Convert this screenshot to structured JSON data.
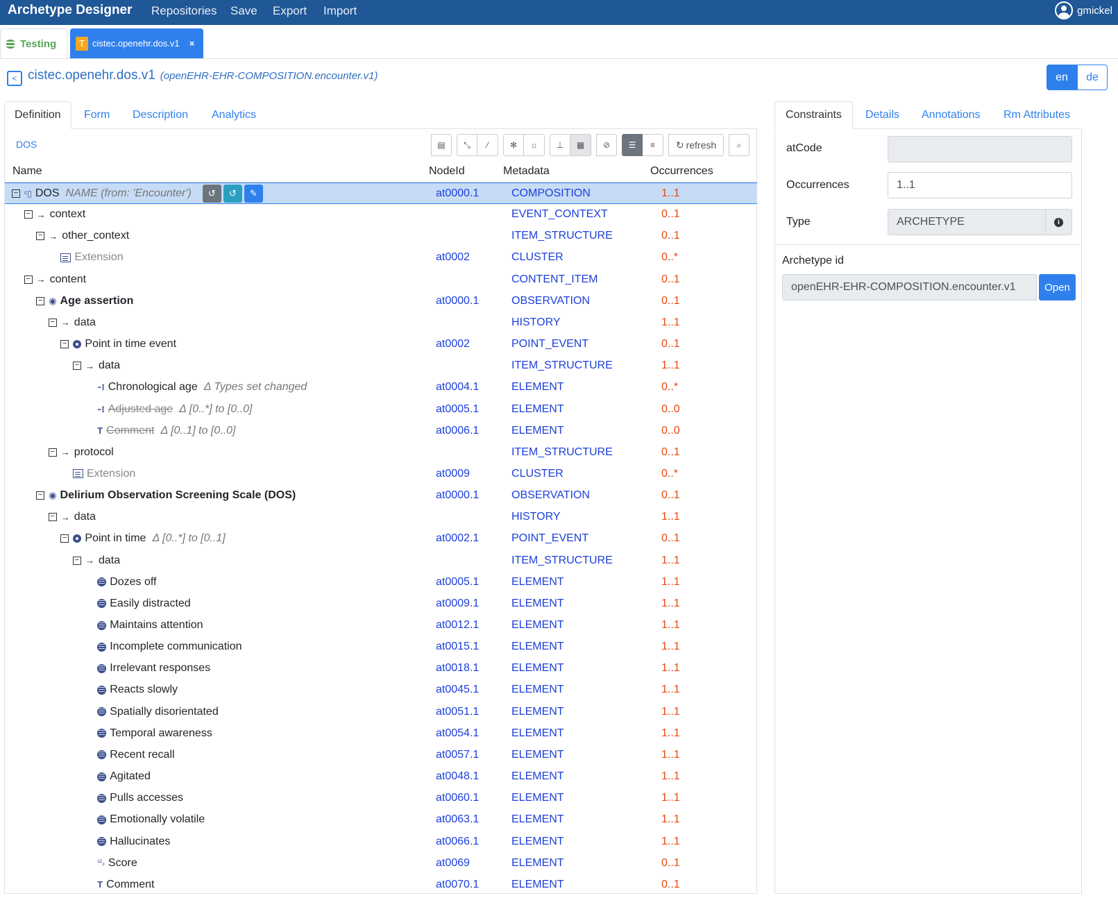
{
  "navbar": {
    "brand": "Archetype Designer",
    "items": [
      "Repositories",
      "Save",
      "Export",
      "Import"
    ],
    "user": "gmickel"
  },
  "doc_tabs": {
    "testing": "Testing",
    "active_badge": "T",
    "active": "cistec.openehr.dos.v1",
    "close": "×"
  },
  "title": {
    "main": "cistec.openehr.dos.v1",
    "sub": "(openEHR-EHR-COMPOSITION.encounter.v1)"
  },
  "lang": {
    "en": "en",
    "de": "de"
  },
  "left_tabs": [
    "Definition",
    "Form",
    "Description",
    "Analytics"
  ],
  "toolbar": {
    "root_link": "DOS",
    "refresh": "refresh"
  },
  "table": {
    "headers": {
      "name": "Name",
      "node": "NodeId",
      "meta": "Metadata",
      "occ": "Occurrences"
    },
    "rows": [
      {
        "depth": 0,
        "toggle": true,
        "icon": "composition-icon",
        "name": "DOS",
        "note": "NAME (from: 'Encounter')",
        "node": "at0000.1",
        "meta": "COMPOSITION",
        "occ": "1..1",
        "selected": true
      },
      {
        "depth": 1,
        "toggle": true,
        "arrow": true,
        "name": "context",
        "node": "",
        "meta": "EVENT_CONTEXT",
        "occ": "0..1"
      },
      {
        "depth": 2,
        "toggle": true,
        "arrow": true,
        "name": "other_context",
        "node": "",
        "meta": "ITEM_STRUCTURE",
        "occ": "0..1"
      },
      {
        "depth": 4,
        "icon": "cluster-icon",
        "name": "Extension",
        "grey": true,
        "node": "at0002",
        "meta": "CLUSTER",
        "occ": "0..*"
      },
      {
        "depth": 1,
        "toggle": true,
        "arrow": true,
        "name": "content",
        "node": "",
        "meta": "CONTENT_ITEM",
        "occ": "0..1"
      },
      {
        "depth": 2,
        "toggle": true,
        "icon": "eye-icon",
        "name": "Age assertion",
        "bold": true,
        "node": "at0000.1",
        "meta": "OBSERVATION",
        "occ": "0..1"
      },
      {
        "depth": 3,
        "toggle": true,
        "arrow": true,
        "name": "data",
        "node": "",
        "meta": "HISTORY",
        "occ": "1..1"
      },
      {
        "depth": 4,
        "toggle": true,
        "icon": "event-icon",
        "name": "Point in time event",
        "node": "at0002",
        "meta": "POINT_EVENT",
        "occ": "0..1"
      },
      {
        "depth": 5,
        "toggle": true,
        "arrow": true,
        "name": "data",
        "node": "",
        "meta": "ITEM_STRUCTURE",
        "occ": "1..1"
      },
      {
        "depth": 7,
        "icon": "duration-icon",
        "name": "Chronological age",
        "note": "Δ Types set changed",
        "node": "at0004.1",
        "meta": "ELEMENT",
        "occ": "0..*"
      },
      {
        "depth": 7,
        "icon": "duration-icon",
        "name": "Adjusted age",
        "strike": true,
        "note": "Δ [0..*] to [0..0]",
        "node": "at0005.1",
        "meta": "ELEMENT",
        "occ": "0..0"
      },
      {
        "depth": 7,
        "icon": "text-icon",
        "name": "Comment",
        "strike": true,
        "note": "Δ [0..1] to [0..0]",
        "node": "at0006.1",
        "meta": "ELEMENT",
        "occ": "0..0"
      },
      {
        "depth": 3,
        "toggle": true,
        "arrow": true,
        "name": "protocol",
        "node": "",
        "meta": "ITEM_STRUCTURE",
        "occ": "0..1"
      },
      {
        "depth": 5,
        "icon": "cluster-icon",
        "name": "Extension",
        "grey": true,
        "node": "at0009",
        "meta": "CLUSTER",
        "occ": "0..*"
      },
      {
        "depth": 2,
        "toggle": true,
        "icon": "eye-icon",
        "name": "Delirium Observation Screening Scale (DOS)",
        "bold": true,
        "node": "at0000.1",
        "meta": "OBSERVATION",
        "occ": "0..1"
      },
      {
        "depth": 3,
        "toggle": true,
        "arrow": true,
        "name": "data",
        "node": "",
        "meta": "HISTORY",
        "occ": "1..1"
      },
      {
        "depth": 4,
        "toggle": true,
        "icon": "event-icon",
        "name": "Point in time",
        "note": "Δ [0..*] to [0..1]",
        "node": "at0002.1",
        "meta": "POINT_EVENT",
        "occ": "0..1"
      },
      {
        "depth": 5,
        "toggle": true,
        "arrow": true,
        "name": "data",
        "node": "",
        "meta": "ITEM_STRUCTURE",
        "occ": "1..1"
      },
      {
        "depth": 7,
        "icon": "coded-text-icon",
        "name": "Dozes off",
        "node": "at0005.1",
        "meta": "ELEMENT",
        "occ": "1..1"
      },
      {
        "depth": 7,
        "icon": "coded-text-icon",
        "name": "Easily distracted",
        "node": "at0009.1",
        "meta": "ELEMENT",
        "occ": "1..1"
      },
      {
        "depth": 7,
        "icon": "coded-text-icon",
        "name": "Maintains attention",
        "node": "at0012.1",
        "meta": "ELEMENT",
        "occ": "1..1"
      },
      {
        "depth": 7,
        "icon": "coded-text-icon",
        "name": "Incomplete communication",
        "node": "at0015.1",
        "meta": "ELEMENT",
        "occ": "1..1"
      },
      {
        "depth": 7,
        "icon": "coded-text-icon",
        "name": "Irrelevant responses",
        "node": "at0018.1",
        "meta": "ELEMENT",
        "occ": "1..1"
      },
      {
        "depth": 7,
        "icon": "coded-text-icon",
        "name": "Reacts slowly",
        "node": "at0045.1",
        "meta": "ELEMENT",
        "occ": "1..1"
      },
      {
        "depth": 7,
        "icon": "coded-text-icon",
        "name": "Spatially disorientated",
        "node": "at0051.1",
        "meta": "ELEMENT",
        "occ": "1..1"
      },
      {
        "depth": 7,
        "icon": "coded-text-icon",
        "name": "Temporal awareness",
        "node": "at0054.1",
        "meta": "ELEMENT",
        "occ": "1..1"
      },
      {
        "depth": 7,
        "icon": "coded-text-icon",
        "name": "Recent recall",
        "node": "at0057.1",
        "meta": "ELEMENT",
        "occ": "1..1"
      },
      {
        "depth": 7,
        "icon": "coded-text-icon",
        "name": "Agitated",
        "node": "at0048.1",
        "meta": "ELEMENT",
        "occ": "1..1"
      },
      {
        "depth": 7,
        "icon": "coded-text-icon",
        "name": "Pulls accesses",
        "node": "at0060.1",
        "meta": "ELEMENT",
        "occ": "1..1"
      },
      {
        "depth": 7,
        "icon": "coded-text-icon",
        "name": "Emotionally volatile",
        "node": "at0063.1",
        "meta": "ELEMENT",
        "occ": "1..1"
      },
      {
        "depth": 7,
        "icon": "coded-text-icon",
        "name": "Hallucinates",
        "node": "at0066.1",
        "meta": "ELEMENT",
        "occ": "1..1"
      },
      {
        "depth": 7,
        "icon": "count-icon",
        "name": "Score",
        "node": "at0069",
        "meta": "ELEMENT",
        "occ": "0..1"
      },
      {
        "depth": 7,
        "icon": "text-icon",
        "name": "Comment",
        "node": "at0070.1",
        "meta": "ELEMENT",
        "occ": "0..1"
      }
    ]
  },
  "right_tabs": [
    "Constraints",
    "Details",
    "Annotations",
    "Rm Attributes"
  ],
  "constraints": {
    "atcode_label": "atCode",
    "atcode_value": "",
    "occ_label": "Occurrences",
    "occ_value": "1..1",
    "type_label": "Type",
    "type_value": "ARCHETYPE",
    "archetype_id_label": "Archetype id",
    "archetype_id_value": "openEHR-EHR-COMPOSITION.encounter.v1",
    "open_button": "Open"
  },
  "colors": {
    "navbar": "#1f5797",
    "accent": "#2f80ed",
    "node_text": "#1c3fdb",
    "occurrence_text": "#e8490f",
    "selected_row": "#c6dcf6",
    "testing_tab": "#5aa55a"
  }
}
